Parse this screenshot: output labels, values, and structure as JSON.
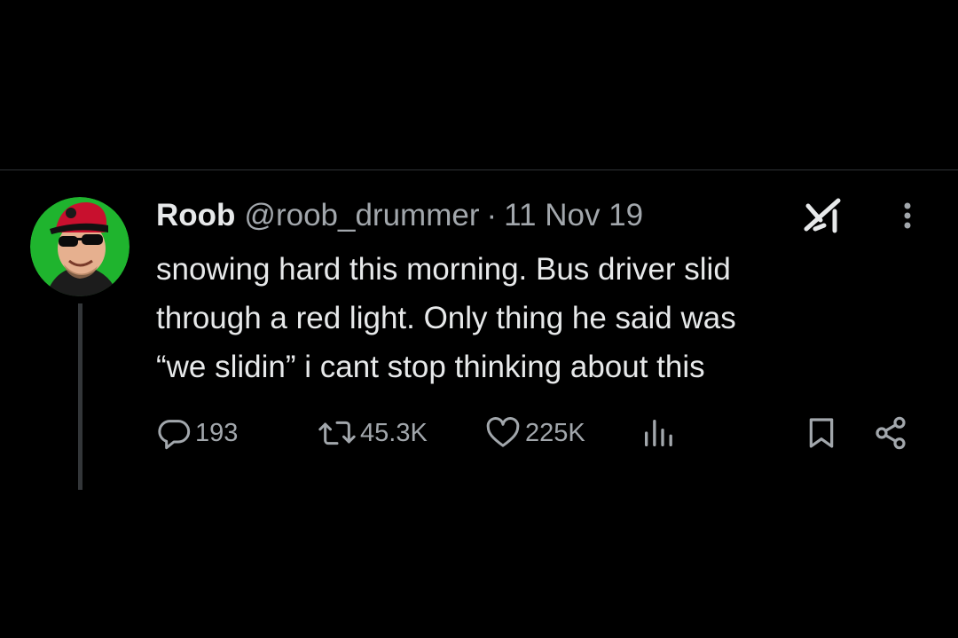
{
  "tweet": {
    "author": {
      "display_name": "Roob",
      "handle": "@roob_drummer",
      "avatar": "avatar-photo"
    },
    "separator": "·",
    "date": "11 Nov 19",
    "text": "snowing hard this morning. Bus driver slid\nthrough a red light. Only thing he said was\n“we slidin” i cant stop thinking about this",
    "icons": {
      "grok": "grok-icon",
      "more": "more-icon"
    }
  },
  "actions": {
    "reply": {
      "icon": "reply-icon",
      "count": "193"
    },
    "retweet": {
      "icon": "retweet-icon",
      "count": "45.3K"
    },
    "like": {
      "icon": "like-icon",
      "count": "225K"
    },
    "views": {
      "icon": "views-icon",
      "count": ""
    },
    "bookmark": {
      "icon": "bookmark-icon"
    },
    "share": {
      "icon": "share-icon"
    }
  },
  "colors": {
    "background": "#000000",
    "text_primary": "#e7e9ea",
    "text_secondary": "#a2a7ac",
    "divider": "#2f3336",
    "thread_line": "#333639"
  }
}
